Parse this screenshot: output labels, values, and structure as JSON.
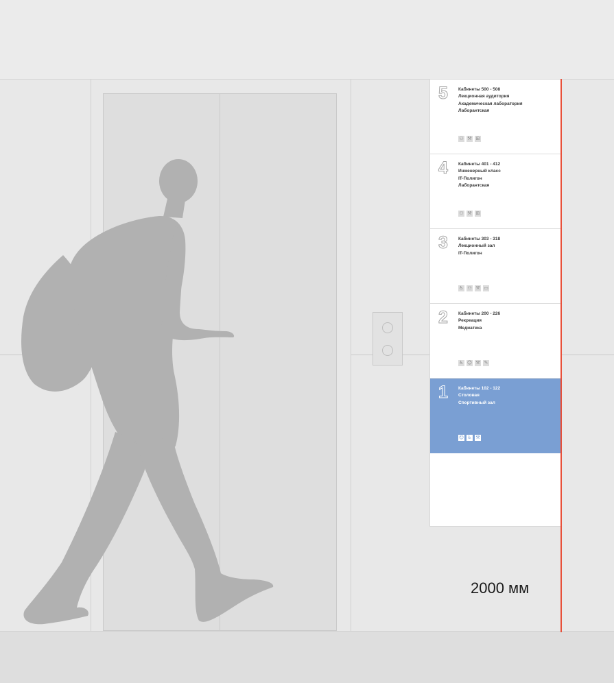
{
  "sign": {
    "floors": [
      {
        "number": "5",
        "rooms": [
          "Кабинеты 500 - 508",
          "Лекционная аудитория",
          "Академическая лаборатория",
          "Лаборантская"
        ],
        "icons": [
          "people-icon",
          "tools-icon",
          "grid-icon"
        ],
        "active": false
      },
      {
        "number": "4",
        "rooms": [
          "Кабинеты 401 - 412",
          "Инженерный класс",
          "IT-Полигон",
          "Лаборантская"
        ],
        "icons": [
          "people-icon",
          "tools-icon",
          "grid-icon"
        ],
        "active": false
      },
      {
        "number": "3",
        "rooms": [
          "Кабинеты 303 - 318",
          "Лекционный зал",
          "IT-Полигон"
        ],
        "icons": [
          "accessibility-icon",
          "people-icon",
          "tools-icon",
          "screen-icon"
        ],
        "active": false
      },
      {
        "number": "2",
        "rooms": [
          "Кабинеты 200 - 226",
          "Рекреация",
          "Медиатека"
        ],
        "icons": [
          "accessibility-icon",
          "person-icon",
          "tools-icon",
          "pen-icon"
        ],
        "active": false
      },
      {
        "number": "1",
        "rooms": [
          "Кабинеты 102 - 122",
          "Столовая",
          "Спортивный зал"
        ],
        "icons": [
          "person-icon",
          "accessibility-icon",
          "tools-icon"
        ],
        "active": true
      }
    ],
    "active_color": "#7a9fd3"
  },
  "dimension": {
    "label": "2000 мм",
    "line_color": "#e8503a"
  }
}
